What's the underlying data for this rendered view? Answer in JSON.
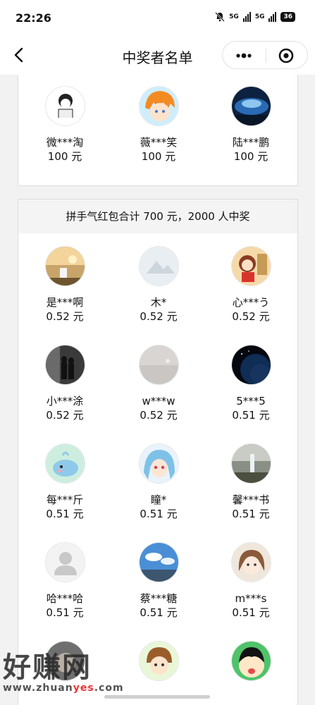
{
  "status_bar": {
    "time": "22:26",
    "signal1": "5G",
    "signal2": "5G",
    "battery": "36"
  },
  "nav": {
    "title": "中奖者名单"
  },
  "top_winners": [
    {
      "name": "微***淘",
      "amount": "100 元"
    },
    {
      "name": "薇***笑",
      "amount": "100 元"
    },
    {
      "name": "陆***鹏",
      "amount": "100 元"
    }
  ],
  "main_card": {
    "header": "拼手气红包合计 700 元，2000 人中奖"
  },
  "winners": [
    {
      "name": "是***啊",
      "amount": "0.52 元"
    },
    {
      "name": "木*",
      "amount": "0.52 元"
    },
    {
      "name": "心***う",
      "amount": "0.52 元"
    },
    {
      "name": "小***涂",
      "amount": "0.52 元"
    },
    {
      "name": "w***w",
      "amount": "0.52 元"
    },
    {
      "name": "5***5",
      "amount": "0.51 元"
    },
    {
      "name": "每***斤",
      "amount": "0.51 元"
    },
    {
      "name": "瞳*",
      "amount": "0.51 元"
    },
    {
      "name": "馨***书",
      "amount": "0.51 元"
    },
    {
      "name": "哈***哈",
      "amount": "0.51 元"
    },
    {
      "name": "蔡***糖",
      "amount": "0.51 元"
    },
    {
      "name": "m***s",
      "amount": "0.51 元"
    }
  ],
  "watermark": {
    "main": "好赚网",
    "url_prefix": "www.zhuan",
    "url_highlight": "yes",
    "url_suffix": ".com"
  },
  "colors": {
    "page_bg": "#f2f2f2",
    "card_border": "#dcdcdc",
    "header_bg": "#f4f4f4"
  }
}
